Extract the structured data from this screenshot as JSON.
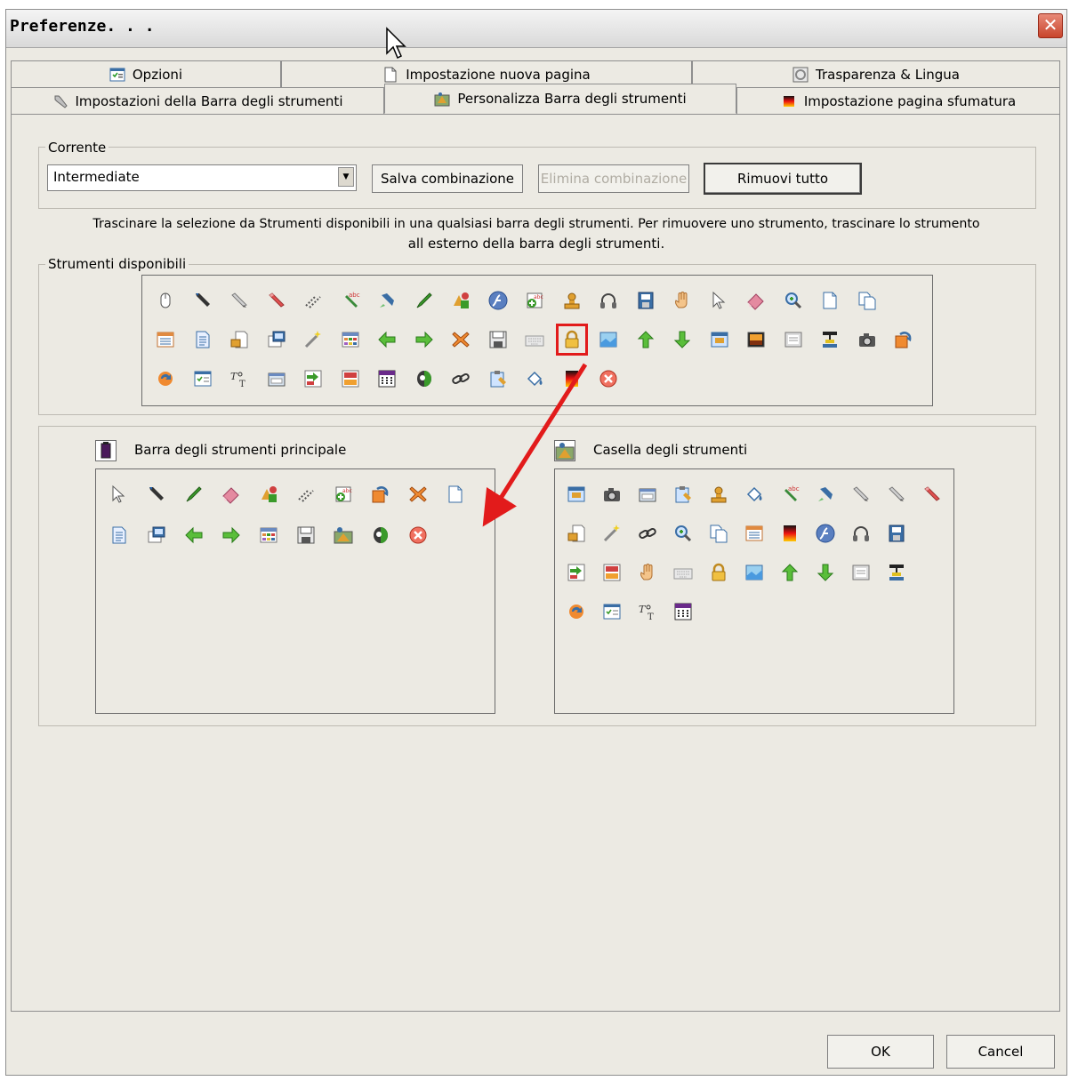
{
  "window": {
    "title": "Preferenze. . ."
  },
  "tabs": {
    "row1": [
      {
        "label": "Opzioni",
        "icon": "options-window-icon"
      },
      {
        "label": "Impostazione nuova pagina",
        "icon": "page-icon"
      },
      {
        "label": "Trasparenza & Lingua",
        "icon": "transparency-icon"
      }
    ],
    "row2": [
      {
        "label": "Impostazioni della Barra degli strumenti",
        "icon": "wrench-icon"
      },
      {
        "label": "Personalizza Barra degli strumenti",
        "icon": "toolbox-icon",
        "active": true
      },
      {
        "label": "Impostazione pagina sfumatura",
        "icon": "gradient-icon"
      }
    ]
  },
  "corrente": {
    "legend": "Corrente",
    "selected": "Intermediate",
    "save_label": "Salva combinazione",
    "delete_label": "Elimina combinazione",
    "remove_all_label": "Rimuovi tutto"
  },
  "instructions": {
    "line1": "Trascinare la selezione da Strumenti disponibili in una qualsiasi barra degli strumenti. Per rimuovere uno strumento, trascinare lo strumento",
    "line2": "all esterno della barra degli strumenti."
  },
  "available": {
    "legend": "Strumenti disponibili",
    "selected_tool": "lock-icon",
    "rows": [
      [
        "mouse-icon",
        "pen-icon",
        "pencil-icon",
        "eraser-pencil-icon",
        "line-icon",
        "spellcheck-icon",
        "highlighter-icon",
        "marker-icon",
        "shapes-icon",
        "flash-icon",
        "spell-add-icon",
        "stamp-icon",
        "headphones-icon",
        "floppy-blue-icon",
        "hand-icon",
        "pointer-icon",
        "eraser-icon",
        "zoom-icon",
        "new-page-icon",
        "copy-page-icon"
      ],
      [
        "calendar-icon",
        "document-icon",
        "page-import-icon",
        "screen-capture-icon",
        "magic-wand-icon",
        "table-icon",
        "back-arrow-icon",
        "forward-arrow-icon",
        "delete-x-icon",
        "save-icon",
        "keyboard-icon",
        "lock-icon",
        "picture-icon",
        "up-arrow-icon",
        "down-arrow-icon",
        "projector-icon",
        "image-icon",
        "frame-icon",
        "network-icon",
        "camera-icon",
        "undo-icon"
      ],
      [
        "refresh-icon",
        "checklist-icon",
        "text-icon",
        "window-icon",
        "import-icon",
        "export-icon",
        "grid-calendar-icon",
        "reveal-icon",
        "link-icon",
        "paste-icon",
        "fill-icon",
        "gradient-icon",
        "close-circle-icon"
      ]
    ]
  },
  "main_toolbar": {
    "label": "Barra degli strumenti principale",
    "icon": "main-toolbar-icon",
    "rows": [
      [
        "pointer-icon",
        "pen-icon",
        "marker-icon",
        "eraser-icon",
        "shapes-icon",
        "line-icon",
        "spell-add-icon",
        "undo-icon",
        "delete-x-icon",
        "new-page-icon"
      ],
      [
        "document-icon",
        "screen-capture-icon",
        "back-arrow-icon",
        "forward-arrow-icon",
        "table-icon",
        "save-icon",
        "toolbox-icon",
        "reveal-icon",
        "close-circle-icon"
      ]
    ]
  },
  "toolbox": {
    "label": "Casella degli strumenti",
    "icon": "toolbox-icon",
    "rows": [
      [
        "projector-icon",
        "camera-icon",
        "window-icon",
        "paste-icon",
        "stamp-icon",
        "fill-icon",
        "spellcheck-icon",
        "highlighter-icon",
        "pencil-icon",
        "pencil-icon",
        "eraser-pencil-icon"
      ],
      [
        "page-import-icon",
        "magic-wand-icon",
        "link-icon",
        "zoom-icon",
        "copy-page-icon",
        "calendar-icon",
        "gradient-icon",
        "flash-icon",
        "headphones-icon",
        "floppy-blue-icon"
      ],
      [
        "import-icon",
        "export-icon",
        "hand-icon",
        "keyboard-icon",
        "lock-icon",
        "picture-icon",
        "up-arrow-icon",
        "down-arrow-icon",
        "frame-icon",
        "network-icon"
      ],
      [
        "refresh-icon",
        "checklist-icon",
        "text-icon",
        "grid-calendar-icon"
      ]
    ]
  },
  "footer": {
    "ok_label": "OK",
    "cancel_label": "Cancel"
  },
  "colors": {
    "accent_red": "#e21b1b",
    "dialog_bg": "#eceae3"
  }
}
